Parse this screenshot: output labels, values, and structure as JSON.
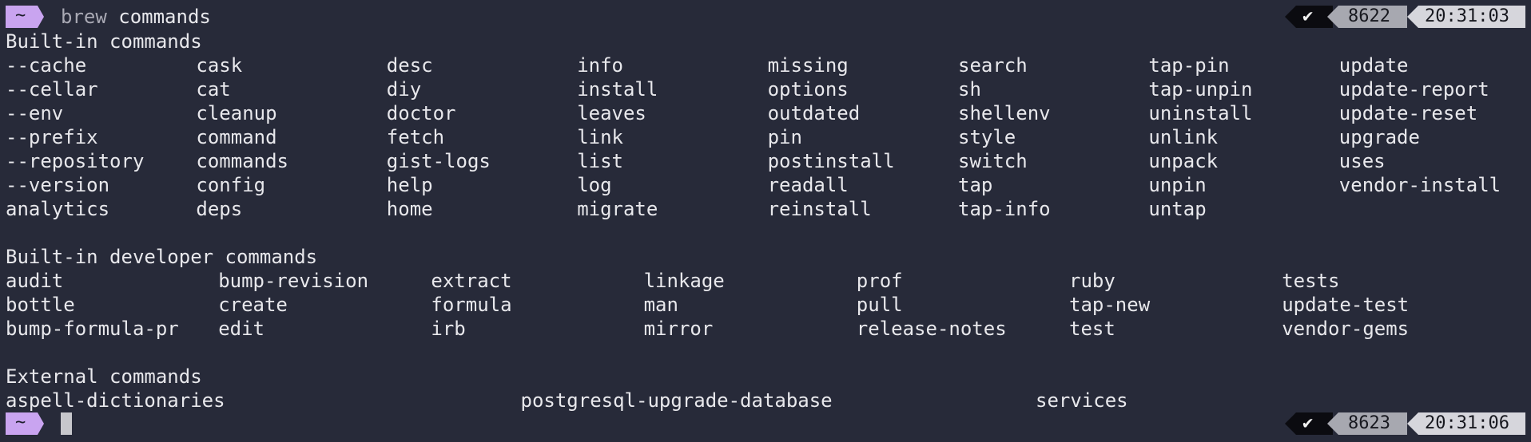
{
  "top_prompt": {
    "symbol": "~",
    "command_dim": "brew",
    "command_rest": " commands",
    "status_check": "✔",
    "history_number": "8622",
    "time": "20:31:03"
  },
  "builtin": {
    "heading": "Built-in commands",
    "rows": [
      [
        "--cache",
        "cask",
        "desc",
        "info",
        "missing",
        "search",
        "tap-pin",
        "update"
      ],
      [
        "--cellar",
        "cat",
        "diy",
        "install",
        "options",
        "sh",
        "tap-unpin",
        "update-report"
      ],
      [
        "--env",
        "cleanup",
        "doctor",
        "leaves",
        "outdated",
        "shellenv",
        "uninstall",
        "update-reset"
      ],
      [
        "--prefix",
        "command",
        "fetch",
        "link",
        "pin",
        "style",
        "unlink",
        "upgrade"
      ],
      [
        "--repository",
        "commands",
        "gist-logs",
        "list",
        "postinstall",
        "switch",
        "unpack",
        "uses"
      ],
      [
        "--version",
        "config",
        "help",
        "log",
        "readall",
        "tap",
        "unpin",
        "vendor-install"
      ],
      [
        "analytics",
        "deps",
        "home",
        "migrate",
        "reinstall",
        "tap-info",
        "untap",
        ""
      ]
    ]
  },
  "developer": {
    "heading": "Built-in developer commands",
    "rows": [
      [
        "audit",
        "bump-revision",
        "extract",
        "linkage",
        "prof",
        "ruby",
        "tests"
      ],
      [
        "bottle",
        "create",
        "formula",
        "man",
        "pull",
        "tap-new",
        "update-test"
      ],
      [
        "bump-formula-pr",
        "edit",
        "irb",
        "mirror",
        "release-notes",
        "test",
        "vendor-gems"
      ]
    ]
  },
  "external": {
    "heading": "External commands",
    "rows": [
      [
        "aspell-dictionaries",
        "postgresql-upgrade-database",
        "services"
      ]
    ]
  },
  "bottom_prompt": {
    "symbol": "~",
    "status_check": "✔",
    "history_number": "8623",
    "time": "20:31:06"
  },
  "colors": {
    "background": "#272a39",
    "foreground": "#e8e8ec",
    "prompt_badge": "#c9a4f0",
    "status_ok_bg": "#0b0b10",
    "status_num_bg": "#a7a8b0",
    "status_time_bg": "#d6d6dc"
  }
}
